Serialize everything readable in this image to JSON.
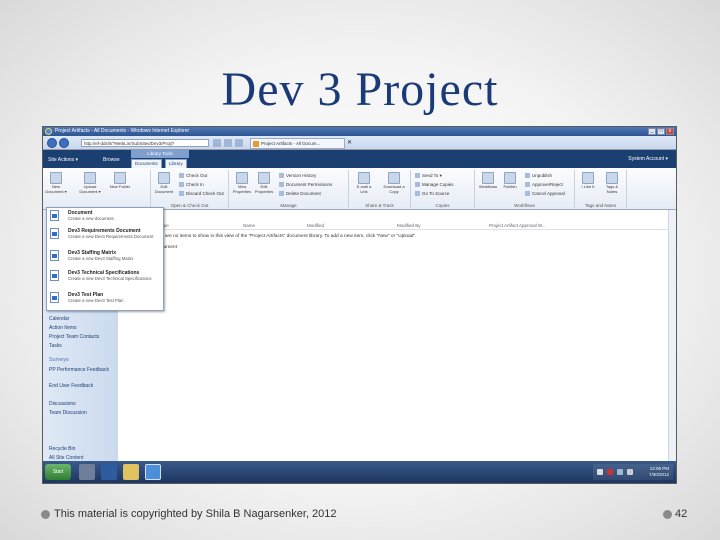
{
  "slide": {
    "title": "Dev 3 Project",
    "footer": "This material is copyrighted by Shila B Nagarsenker, 2012",
    "page_number": "42"
  },
  "browser": {
    "window_title": "Project Artifacts - All Documents - Windows Internet Explorer",
    "address": "http://ef-dds/it/?WebLin/SubSites/Dev3/Projt?",
    "tab_label": "Project Artifacts - All Docum...",
    "tab_close": "✕",
    "win_controls": [
      "_",
      "□",
      "x"
    ]
  },
  "ribbon": {
    "site_actions": "Site Actions ▾",
    "browse_tab": "Browse",
    "library_tools": "Library Tools",
    "tabs": [
      "Documents",
      "Library"
    ],
    "system_account": "System Account ▾",
    "buttons": {
      "new_document": "New Document ▾",
      "upload": "Upload Document ▾",
      "new_folder": "New Folder",
      "edit_document": "Edit Document",
      "view_properties": "View Properties",
      "edit_properties": "Edit Properties",
      "email_link": "E-mail a Link",
      "download_copy": "Download a Copy",
      "workflows": "Workflows",
      "publish": "Publish",
      "i_like_it": "I Like It",
      "tags_notes": "Tags & Notes"
    },
    "small": {
      "check_out": "Check Out",
      "check_in": "Check In",
      "discard_check_out": "Discard Check Out",
      "version_history": "Version History",
      "document_permissions": "Document Permissions",
      "delete_document": "Delete Document",
      "send_to": "Send To ▾",
      "manage_copies": "Manage Copies",
      "go_to_source": "Go To Source",
      "unpublish": "Unpublish",
      "approve_reject": "Approve/Reject",
      "cancel_approval": "Cancel Approval"
    },
    "groups": [
      "Open & Check Out",
      "Manage",
      "Share & Track",
      "Copies",
      "Workflows",
      "Tags and Notes"
    ]
  },
  "dropdown": {
    "items": [
      {
        "title": "Document",
        "desc": "Create a new document."
      },
      {
        "title": "Dev3 Requirements Document",
        "desc": "Create a new Dev3 Requirements Document"
      },
      {
        "title": "Dev3 Staffing Matrix",
        "desc": "Create a new Dev3 Staffing Matrix"
      },
      {
        "title": "Dev3 Technical Specifications",
        "desc": "Create a new Dev3 Technical Specifications"
      },
      {
        "title": "Dev3 Test Plan",
        "desc": "Create a new Dev3 Test Plan"
      }
    ]
  },
  "leftnav": {
    "items": [
      "Calendar",
      "Action Items",
      "Project Team Contacts",
      "Tasks"
    ],
    "surveys_head": "Surveys",
    "surveys": [
      "PP Performance Feedback",
      "End User Feedback"
    ],
    "discussions": [
      "Discussions",
      "Team Discussion"
    ],
    "bottom": [
      "Recycle Bin",
      "All Site Content"
    ]
  },
  "list": {
    "columns": [
      "Type",
      "Name",
      "Modified",
      "Modified By",
      "Project Artifact Approval W..."
    ],
    "empty_message": "There are no items to show in this view of the \"Project Artifacts\" document library. To add a new item, click \"New\" or \"Upload\".",
    "add_document": "Add document"
  },
  "taskbar": {
    "start": "Start",
    "time": "12:06 PM",
    "date": "7/30/2012"
  }
}
